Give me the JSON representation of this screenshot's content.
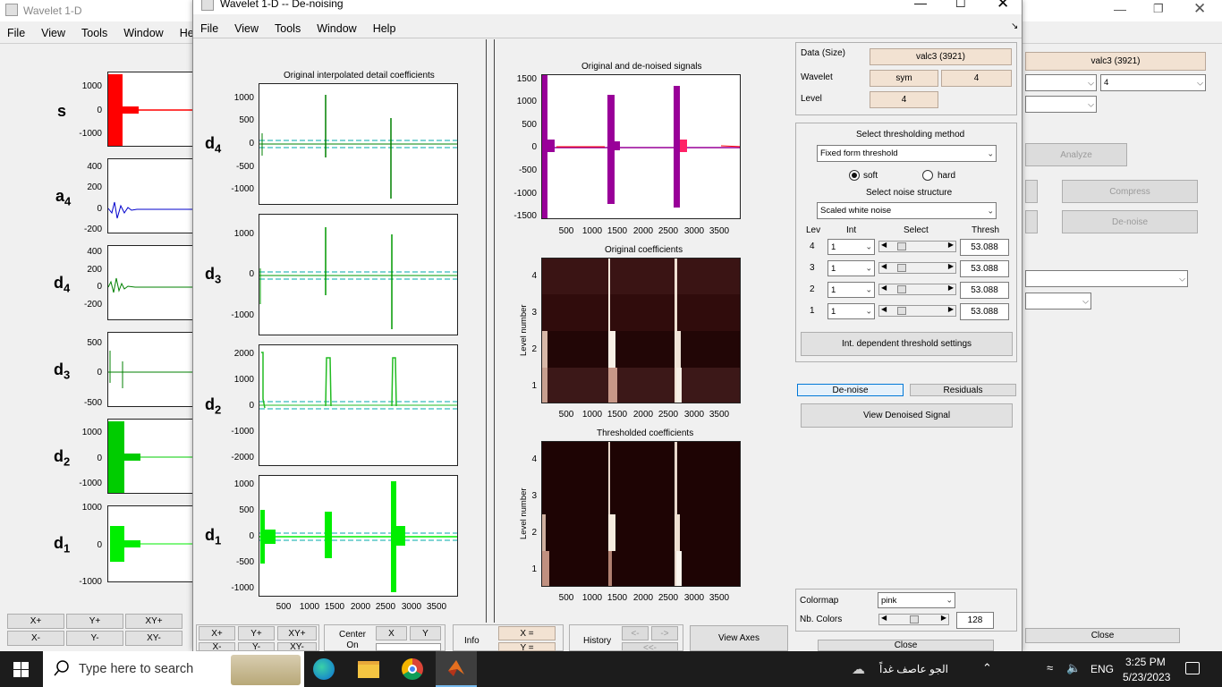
{
  "bg_window": {
    "title": "Wavelet 1-D",
    "menu": [
      "File",
      "View",
      "Tools",
      "Window",
      "Help"
    ],
    "row_labels": {
      "s": "s",
      "a4_main": "a",
      "a4_sub": "4",
      "d4_main": "d",
      "d4_sub": "4",
      "d3_main": "d",
      "d3_sub": "3",
      "d2_main": "d",
      "d2_sub": "2",
      "d1_main": "d",
      "d1_sub": "1"
    },
    "ticks": {
      "s": [
        "1000",
        "0",
        "-1000"
      ],
      "a4": [
        "400",
        "200",
        "0",
        "-200"
      ],
      "d4": [
        "400",
        "200",
        "0",
        "-200"
      ],
      "d3": [
        "500",
        "0",
        "-500"
      ],
      "d2": [
        "1000",
        "0",
        "-1000"
      ],
      "d1": [
        "1000",
        "0",
        "-1000"
      ]
    },
    "zoom_buttons": [
      "X+",
      "Y+",
      "XY+",
      "X-",
      "Y-",
      "XY-"
    ],
    "right_field": "valc3  (3921)",
    "level_select": "4",
    "analyze_button": "Analyze",
    "compress_button": "Compress",
    "denoise_button": "De-noise",
    "close_button": "Close"
  },
  "fg_window": {
    "title": "Wavelet 1-D  --  De-noising",
    "menu": [
      "File",
      "View",
      "Tools",
      "Window",
      "Help"
    ],
    "left_title": "Original interpolated detail coefficients",
    "left_labels": [
      {
        "main": "d",
        "sub": "4"
      },
      {
        "main": "d",
        "sub": "3"
      },
      {
        "main": "d",
        "sub": "2"
      },
      {
        "main": "d",
        "sub": "1"
      }
    ],
    "left_ticks": {
      "d4": [
        "1000",
        "500",
        "0",
        "-500",
        "-1000"
      ],
      "d3": [
        "1000",
        "0",
        "-1000"
      ],
      "d2": [
        "2000",
        "1000",
        "0",
        "-1000",
        "-2000"
      ],
      "d1": [
        "1000",
        "500",
        "0",
        "-500",
        "-1000"
      ]
    },
    "x_ticks": [
      "500",
      "1000",
      "1500",
      "2000",
      "2500",
      "3000",
      "3500"
    ],
    "signal_title": "Original and de-noised signals",
    "signal_yticks": [
      "1500",
      "1000",
      "500",
      "0",
      "-500",
      "-1000",
      "-1500"
    ],
    "orig_coef_title": "Original coefficients",
    "thresh_coef_title": "Thresholded coefficients",
    "level_axis_label": "Level number",
    "level_ticks": [
      "4",
      "3",
      "2",
      "1"
    ],
    "bottom_zoom": [
      "X+",
      "Y+",
      "XY+",
      "X-",
      "Y-",
      "XY-"
    ],
    "center_on": {
      "label": "Center On",
      "x": "X",
      "y": "Y"
    },
    "info_label": "Info",
    "info_x": "X =",
    "info_y": "Y =",
    "history_label": "History",
    "history_back": "<-",
    "history_fwd": "->",
    "history_reset": "<<-",
    "view_axes": "View Axes"
  },
  "control_panel": {
    "data_label": "Data  (Size)",
    "data_value": "valc3  (3921)",
    "wavelet_label": "Wavelet",
    "wavelet_family": "sym",
    "wavelet_order": "4",
    "level_label": "Level",
    "level_value": "4",
    "thresh_method_title": "Select thresholding method",
    "thresh_method": "Fixed form threshold",
    "soft_label": "soft",
    "hard_label": "hard",
    "noise_title": "Select noise structure",
    "noise_structure": "Scaled white noise",
    "col_headers": {
      "lev": "Lev",
      "int": "Int",
      "select": "Select",
      "thresh": "Thresh"
    },
    "rows": [
      {
        "lev": "4",
        "int": "1",
        "thresh": "53.088"
      },
      {
        "lev": "3",
        "int": "1",
        "thresh": "53.088"
      },
      {
        "lev": "2",
        "int": "1",
        "thresh": "53.088"
      },
      {
        "lev": "1",
        "int": "1",
        "thresh": "53.088"
      }
    ],
    "int_dep_button": "Int. dependent threshold settings",
    "denoise_button": "De-noise",
    "residuals_button": "Residuals",
    "view_denoised_button": "View Denoised Signal",
    "colormap_label": "Colormap",
    "colormap_value": "pink",
    "nb_colors_label": "Nb. Colors",
    "nb_colors_value": "128",
    "close_button": "Close"
  },
  "taskbar": {
    "search_placeholder": "Type here to search",
    "weather": "الجو عاصف غداً",
    "language": "ENG",
    "time": "3:25 PM",
    "date": "5/23/2023"
  },
  "colors": {
    "signal_original": "#ff0000",
    "signal_denoised": "#990099",
    "detail_green": "#008000",
    "bright_green": "#00dd00",
    "approx_blue": "#0000cc",
    "threshold_dash": "#00aaaa",
    "panel_field": "#f2e2d2"
  }
}
